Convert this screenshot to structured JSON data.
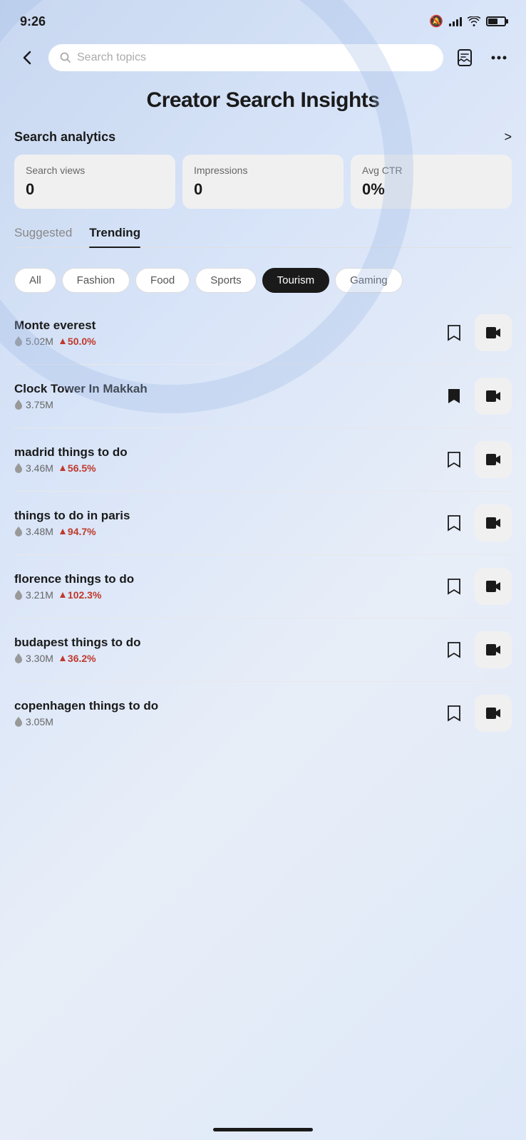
{
  "statusBar": {
    "time": "9:26",
    "hasBell": true
  },
  "navBar": {
    "searchPlaceholder": "Search topics",
    "bookmarkLabel": "bookmark",
    "moreLabel": "more options"
  },
  "pageTitle": "Creator Search Insights",
  "analytics": {
    "headerLabel": "Search analytics",
    "arrowLabel": ">",
    "cards": [
      {
        "label": "Search views",
        "value": "0"
      },
      {
        "label": "Impressions",
        "value": "0"
      },
      {
        "label": "Avg CTR",
        "value": "0%"
      }
    ]
  },
  "tabs": {
    "main": [
      {
        "label": "Suggested",
        "active": false
      },
      {
        "label": "Trending",
        "active": true
      }
    ],
    "categories": [
      {
        "label": "All",
        "active": false
      },
      {
        "label": "Fashion",
        "active": false
      },
      {
        "label": "Food",
        "active": false
      },
      {
        "label": "Sports",
        "active": false
      },
      {
        "label": "Tourism",
        "active": true
      },
      {
        "label": "Gaming",
        "active": false
      }
    ]
  },
  "trendingItems": [
    {
      "title": "Monte everest",
      "views": "5.02M",
      "growth": "50.0%",
      "hasGrowth": true,
      "bookmarked": false,
      "videoActive": false
    },
    {
      "title": "Clock Tower In Makkah",
      "views": "3.75M",
      "growth": null,
      "hasGrowth": false,
      "bookmarked": true,
      "videoActive": false
    },
    {
      "title": "madrid things to do",
      "views": "3.46M",
      "growth": "56.5%",
      "hasGrowth": true,
      "bookmarked": false,
      "videoActive": false
    },
    {
      "title": "things to do in paris",
      "views": "3.48M",
      "growth": "94.7%",
      "hasGrowth": true,
      "bookmarked": false,
      "videoActive": false
    },
    {
      "title": "florence things to do",
      "views": "3.21M",
      "growth": "102.3%",
      "hasGrowth": true,
      "bookmarked": false,
      "videoActive": false
    },
    {
      "title": "budapest things to do",
      "views": "3.30M",
      "growth": "36.2%",
      "hasGrowth": true,
      "bookmarked": false,
      "videoActive": false
    },
    {
      "title": "copenhagen things to do",
      "views": "3.05M",
      "growth": null,
      "hasGrowth": false,
      "bookmarked": false,
      "videoActive": false
    }
  ]
}
